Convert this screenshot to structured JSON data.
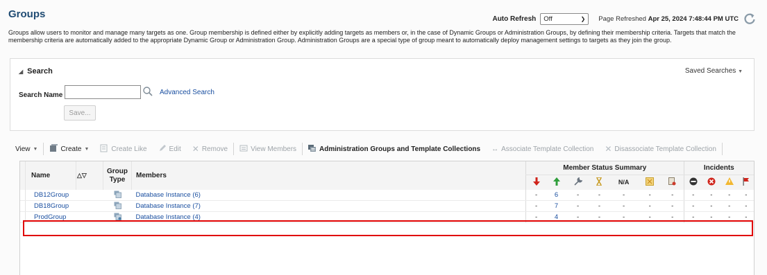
{
  "page": {
    "title": "Groups",
    "auto_refresh_label": "Auto Refresh",
    "auto_refresh_value": "Off",
    "refreshed_prefix": "Page Refreshed",
    "refreshed_time": "Apr 25, 2024 7:48:44 PM UTC",
    "description": "Groups allow users to monitor and manage many targets as one. Group membership is defined either by explicitly adding targets as members or, in the case of Dynamic Groups or Administration Groups, by defining their membership criteria. Targets that match the membership criteria are automatically added to the appropriate Dynamic Group or Administration Group. Administration Groups are a special type of group meant to automatically deploy management settings to targets as they join the group."
  },
  "search": {
    "title": "Search",
    "saved_searches": "Saved Searches",
    "name_label": "Search Name",
    "name_value": "",
    "advanced": "Advanced Search",
    "save": "Save..."
  },
  "toolbar": {
    "view": "View",
    "create": "Create",
    "create_like": "Create Like",
    "edit": "Edit",
    "remove": "Remove",
    "view_members": "View Members",
    "admin_groups": "Administration Groups and Template Collections",
    "associate": "Associate Template Collection",
    "disassociate": "Disassociate Template Collection"
  },
  "table": {
    "col_name": "Name",
    "col_group_type": "Group Type",
    "col_members": "Members",
    "member_status_summary": "Member Status Summary",
    "incidents": "Incidents",
    "na": "N/A",
    "rows": [
      {
        "name": "DB12Group",
        "members": "Database Instance (6)",
        "down": "-",
        "up": "6",
        "c3": "-",
        "c4": "-",
        "c5": "-",
        "c6": "-",
        "c7": "-",
        "i1": "-",
        "i2": "-",
        "i3": "-",
        "i4": "-"
      },
      {
        "name": "DB18Group",
        "members": "Database Instance (7)",
        "down": "-",
        "up": "7",
        "c3": "-",
        "c4": "-",
        "c5": "-",
        "c6": "-",
        "c7": "-",
        "i1": "-",
        "i2": "-",
        "i3": "-",
        "i4": "-"
      },
      {
        "name": "ProdGroup",
        "members": "Database Instance (4)",
        "down": "-",
        "up": "4",
        "c3": "-",
        "c4": "-",
        "c5": "-",
        "c6": "-",
        "c7": "-",
        "i1": "-",
        "i2": "-",
        "i3": "-",
        "i4": "-"
      }
    ]
  },
  "colors": {
    "link": "#1a4fa0",
    "highlight": "#e00000",
    "down": "#d0241b",
    "up": "#2f9e3b"
  }
}
